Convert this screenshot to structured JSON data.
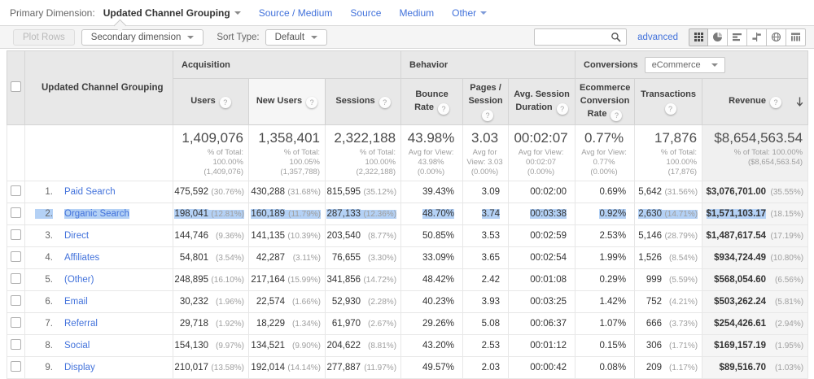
{
  "primary_dimension": {
    "label": "Primary Dimension:",
    "selected": "Updated Channel Grouping",
    "links": [
      "Source / Medium",
      "Source",
      "Medium"
    ],
    "other_label": "Other"
  },
  "toolbar": {
    "plot_rows_label": "Plot Rows",
    "secondary_dimension_label": "Secondary dimension",
    "sort_type_label": "Sort Type:",
    "sort_type_value": "Default",
    "search_value": "",
    "advanced_label": "advanced",
    "active_view": "data-table",
    "view_icons": [
      "data-table",
      "percentage",
      "performance",
      "comparison",
      "term-cloud",
      "pivot"
    ]
  },
  "table": {
    "dimension_header": "Updated Channel Grouping",
    "groups": [
      {
        "label": "Acquisition"
      },
      {
        "label": "Behavior"
      },
      {
        "label": "Conversions",
        "dropdown_value": "eCommerce"
      }
    ],
    "columns": [
      "Users",
      "New Users",
      "Sessions",
      "Bounce Rate",
      "Pages / Session",
      "Avg. Session Duration",
      "Ecommerce Conversion Rate",
      "Transactions",
      "Revenue"
    ],
    "sort": {
      "column": "Revenue",
      "direction": "descending"
    },
    "summary": [
      {
        "value": "1,409,076",
        "sub": "% of Total: 100.00% (1,409,076)"
      },
      {
        "value": "1,358,401",
        "sub": "% of Total: 100.05% (1,357,788)"
      },
      {
        "value": "2,322,188",
        "sub": "% of Total: 100.00% (2,322,188)"
      },
      {
        "value": "43.98%",
        "sub": "Avg for View: 43.98% (0.00%)"
      },
      {
        "value": "3.03",
        "sub": "Avg for View: 3.03 (0.00%)"
      },
      {
        "value": "00:02:07",
        "sub": "Avg for View: 00:02:07 (0.00%)"
      },
      {
        "value": "0.77%",
        "sub": "Avg for View: 0.77% (0.00%)"
      },
      {
        "value": "17,876",
        "sub": "% of Total: 100.00% (17,876)"
      },
      {
        "value": "$8,654,563.54",
        "sub": "% of Total: 100.00% ($8,654,563.54)"
      }
    ],
    "rows": [
      {
        "n": "1.",
        "channel": "Paid Search",
        "users": "475,592",
        "users_pct": "(30.76%)",
        "new_users": "430,288",
        "new_users_pct": "(31.68%)",
        "sessions": "815,595",
        "sessions_pct": "(35.12%)",
        "bounce_rate": "39.43%",
        "pages_per_session": "3.09",
        "avg_session_duration": "00:02:00",
        "ecommerce_conversion_rate": "0.69%",
        "transactions": "5,642",
        "transactions_pct": "(31.56%)",
        "revenue": "$3,076,701.00",
        "revenue_pct": "(35.55%)",
        "selected": false
      },
      {
        "n": "2.",
        "channel": "Organic Search",
        "users": "198,041",
        "users_pct": "(12.81%)",
        "new_users": "160,189",
        "new_users_pct": "(11.79%)",
        "sessions": "287,133",
        "sessions_pct": "(12.36%)",
        "bounce_rate": "48.70%",
        "pages_per_session": "3.74",
        "avg_session_duration": "00:03:38",
        "ecommerce_conversion_rate": "0.92%",
        "transactions": "2,630",
        "transactions_pct": "(14.71%)",
        "revenue": "$1,571,103.17",
        "revenue_pct": "(18.15%)",
        "selected": true
      },
      {
        "n": "3.",
        "channel": "Direct",
        "users": "144,746",
        "users_pct": "(9.36%)",
        "new_users": "141,135",
        "new_users_pct": "(10.39%)",
        "sessions": "203,540",
        "sessions_pct": "(8.77%)",
        "bounce_rate": "50.85%",
        "pages_per_session": "3.53",
        "avg_session_duration": "00:02:59",
        "ecommerce_conversion_rate": "2.53%",
        "transactions": "5,146",
        "transactions_pct": "(28.79%)",
        "revenue": "$1,487,617.54",
        "revenue_pct": "(17.19%)",
        "selected": false
      },
      {
        "n": "4.",
        "channel": "Affiliates",
        "users": "54,801",
        "users_pct": "(3.54%)",
        "new_users": "42,287",
        "new_users_pct": "(3.11%)",
        "sessions": "76,655",
        "sessions_pct": "(3.30%)",
        "bounce_rate": "33.09%",
        "pages_per_session": "3.65",
        "avg_session_duration": "00:02:54",
        "ecommerce_conversion_rate": "1.99%",
        "transactions": "1,526",
        "transactions_pct": "(8.54%)",
        "revenue": "$934,724.49",
        "revenue_pct": "(10.80%)",
        "selected": false
      },
      {
        "n": "5.",
        "channel": "(Other)",
        "users": "248,895",
        "users_pct": "(16.10%)",
        "new_users": "217,164",
        "new_users_pct": "(15.99%)",
        "sessions": "341,856",
        "sessions_pct": "(14.72%)",
        "bounce_rate": "48.42%",
        "pages_per_session": "2.42",
        "avg_session_duration": "00:01:08",
        "ecommerce_conversion_rate": "0.29%",
        "transactions": "999",
        "transactions_pct": "(5.59%)",
        "revenue": "$568,054.60",
        "revenue_pct": "(6.56%)",
        "selected": false
      },
      {
        "n": "6.",
        "channel": "Email",
        "users": "30,232",
        "users_pct": "(1.96%)",
        "new_users": "22,574",
        "new_users_pct": "(1.66%)",
        "sessions": "52,930",
        "sessions_pct": "(2.28%)",
        "bounce_rate": "40.23%",
        "pages_per_session": "3.93",
        "avg_session_duration": "00:03:25",
        "ecommerce_conversion_rate": "1.42%",
        "transactions": "752",
        "transactions_pct": "(4.21%)",
        "revenue": "$503,262.24",
        "revenue_pct": "(5.81%)",
        "selected": false
      },
      {
        "n": "7.",
        "channel": "Referral",
        "users": "29,718",
        "users_pct": "(1.92%)",
        "new_users": "18,229",
        "new_users_pct": "(1.34%)",
        "sessions": "61,970",
        "sessions_pct": "(2.67%)",
        "bounce_rate": "29.26%",
        "pages_per_session": "5.08",
        "avg_session_duration": "00:06:37",
        "ecommerce_conversion_rate": "1.07%",
        "transactions": "666",
        "transactions_pct": "(3.73%)",
        "revenue": "$254,426.61",
        "revenue_pct": "(2.94%)",
        "selected": false
      },
      {
        "n": "8.",
        "channel": "Social",
        "users": "154,130",
        "users_pct": "(9.97%)",
        "new_users": "134,521",
        "new_users_pct": "(9.90%)",
        "sessions": "204,622",
        "sessions_pct": "(8.81%)",
        "bounce_rate": "43.20%",
        "pages_per_session": "2.53",
        "avg_session_duration": "00:01:12",
        "ecommerce_conversion_rate": "0.15%",
        "transactions": "306",
        "transactions_pct": "(1.71%)",
        "revenue": "$169,157.19",
        "revenue_pct": "(1.95%)",
        "selected": false
      },
      {
        "n": "9.",
        "channel": "Display",
        "users": "210,017",
        "users_pct": "(13.58%)",
        "new_users": "192,014",
        "new_users_pct": "(14.14%)",
        "sessions": "277,887",
        "sessions_pct": "(11.97%)",
        "bounce_rate": "49.57%",
        "pages_per_session": "2.03",
        "avg_session_duration": "00:00:42",
        "ecommerce_conversion_rate": "0.08%",
        "transactions": "209",
        "transactions_pct": "(1.17%)",
        "revenue": "$89,516.70",
        "revenue_pct": "(1.03%)",
        "selected": false
      }
    ]
  },
  "colors": {
    "link_blue": "#4272db",
    "selection_highlight": "#b4d1f5",
    "header_gray": "#e8e8e8",
    "toolbar_gray": "#f5f5f5",
    "revenue_column_bg": "#f5f5f5"
  }
}
